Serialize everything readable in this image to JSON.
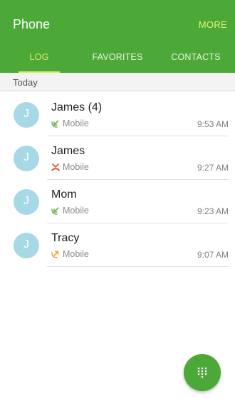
{
  "app": {
    "title": "Phone",
    "more_label": "MORE"
  },
  "tabs": [
    {
      "label": "LOG",
      "active": true
    },
    {
      "label": "FAVORITES",
      "active": false
    },
    {
      "label": "CONTACTS",
      "active": false
    }
  ],
  "log": {
    "section_label": "Today",
    "calls": [
      {
        "initial": "J",
        "name": "James (4)",
        "number_type": "Mobile",
        "call_type": "incoming",
        "time": "9:53 AM"
      },
      {
        "initial": "J",
        "name": "James",
        "number_type": "Mobile",
        "call_type": "missed",
        "time": "9:27 AM"
      },
      {
        "initial": "J",
        "name": "Mom",
        "number_type": "Mobile",
        "call_type": "incoming",
        "time": "9:23 AM"
      },
      {
        "initial": "J",
        "name": "Tracy",
        "number_type": "Mobile",
        "call_type": "outgoing",
        "time": "9:07 AM"
      }
    ]
  },
  "colors": {
    "primary": "#4ca937",
    "accent": "#d9ec6b",
    "avatar": "#a7d8e6",
    "incoming": "#6ab04c",
    "missed": "#e0532f",
    "outgoing": "#e9a13b"
  },
  "icons": {
    "incoming": "incoming-call-icon",
    "missed": "missed-call-icon",
    "outgoing": "outgoing-call-icon",
    "fab": "dialpad-icon"
  }
}
